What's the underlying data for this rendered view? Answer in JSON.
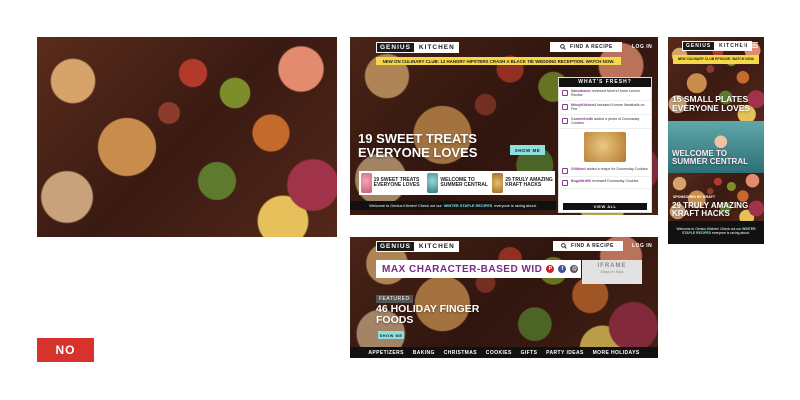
{
  "brand": {
    "genius": "GENIUS",
    "kitchen": "KITCHEN"
  },
  "colors": {
    "accent": "#8ee0e0",
    "ticker": "#f5d84a",
    "purple": "#7a2a86",
    "no": "#d7322c"
  },
  "verdict": "NO",
  "desktop": {
    "find_label": "FIND A RECIPE",
    "login_label": "LOG IN",
    "ticker": "NEW ON CULINARY CLUB: 12 HANGRY HIPSTERS CRASH A BLACK TIE WEDDING RECEPTION. WATCH NOW.",
    "hero_title": "19 SWEET TREATS EVERYONE LOVES",
    "show_me": "SHOW ME",
    "thumbs": [
      {
        "label": "19 SWEET TREATS EVERYONE LOVES"
      },
      {
        "label": "WELCOME TO SUMMER CENTRAL"
      },
      {
        "label": "29 TRULY AMAZING KRAFT HACKS"
      }
    ],
    "footer_pre": "Welcome to Genius Kitchen! Check out our",
    "footer_hl": "WINTER STAPLE RECIPES",
    "footer_post": "everyone is raving about.",
    "fresh": {
      "title": "WHAT'S FRESH?",
      "items": [
        {
          "user": "Saburbanic",
          "text": "reviewed Mom's Home Lemon Ricotta"
        },
        {
          "user": "MissyKitchen4",
          "text": "tweaked Korean Meatballs on Fire"
        },
        {
          "user": "ConnieSmith",
          "text": "added a photo of Doomsday Cookies"
        },
        {
          "user": "Gillblunt",
          "text": "added a recipe for Doomsday Cookies"
        },
        {
          "user": "BugsWrd90",
          "text": "reviewed Doomsday Cookies"
        }
      ],
      "view_all": "VIEW ALL"
    }
  },
  "mobile": {
    "ticker": "NEW CULINARY CLUB EPISODE. WATCH NOW.",
    "block1": "15 SMALL PLATES EVERYONE LOVES",
    "block2": "WELCOME TO SUMMER CENTRAL",
    "sponsored": "SPONSORED BY KRAFT",
    "block3": "29 TRULY AMAZING KRAFT HACKS",
    "footer_pre": "Welcome to Genius Kitchen! Check out our",
    "footer_hl": "WINTER STAPLE RECIPES",
    "footer_post": "everyone is raving about."
  },
  "bottom": {
    "find_label": "FIND A RECIPE",
    "login_label": "LOG IN",
    "max_title": "MAX CHARACTER-BASED WID",
    "iframe_title": "IFRAME",
    "iframe_sub": "Ships to Kips",
    "featured": "FEATURED",
    "title": "46 HOLIDAY FINGER FOODS",
    "show_me": "SHOW ME",
    "categories": [
      "APPETIZERS",
      "BAKING",
      "CHRISTMAS",
      "COOKIES",
      "GIFTS",
      "PARTY IDEAS",
      "MORE HOLIDAYS"
    ]
  }
}
